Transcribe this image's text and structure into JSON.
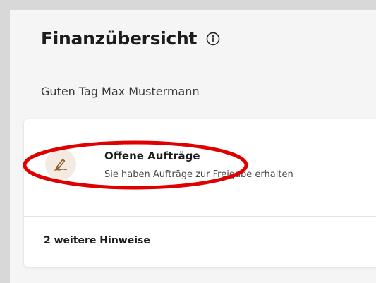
{
  "header": {
    "title": "Finanzübersicht",
    "info_icon": "info-circle-icon"
  },
  "greeting": "Guten Tag Max Mustermann",
  "card": {
    "item": {
      "icon": "signature-pen-icon",
      "title": "Offene Aufträge",
      "subtitle": "Sie haben Aufträge zur Freigabe erhalten"
    },
    "more_hints": "2 weitere Hinweise"
  },
  "colors": {
    "annotation": "#e00000",
    "icon_accent": "#8a5a2b",
    "icon_bg": "#f3ebe2"
  }
}
